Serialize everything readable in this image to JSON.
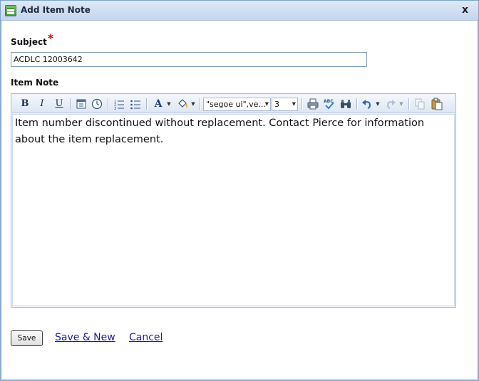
{
  "window": {
    "title": "Add Item Note",
    "close_label": "x"
  },
  "form": {
    "subject_label": "Subject",
    "required_mark": "*",
    "subject_value": "ACDLC 12003642",
    "item_note_label": "Item Note"
  },
  "toolbar": {
    "bold": "B",
    "italic": "I",
    "underline": "U",
    "font_color": "A",
    "font_name": "\"segoe ui\",ve...",
    "font_size": "3"
  },
  "editor": {
    "content": "Item number discontinued without replacement. Contact Pierce for information about the item replacement."
  },
  "actions": {
    "save": "Save",
    "save_new": "Save & New",
    "cancel": "Cancel"
  }
}
